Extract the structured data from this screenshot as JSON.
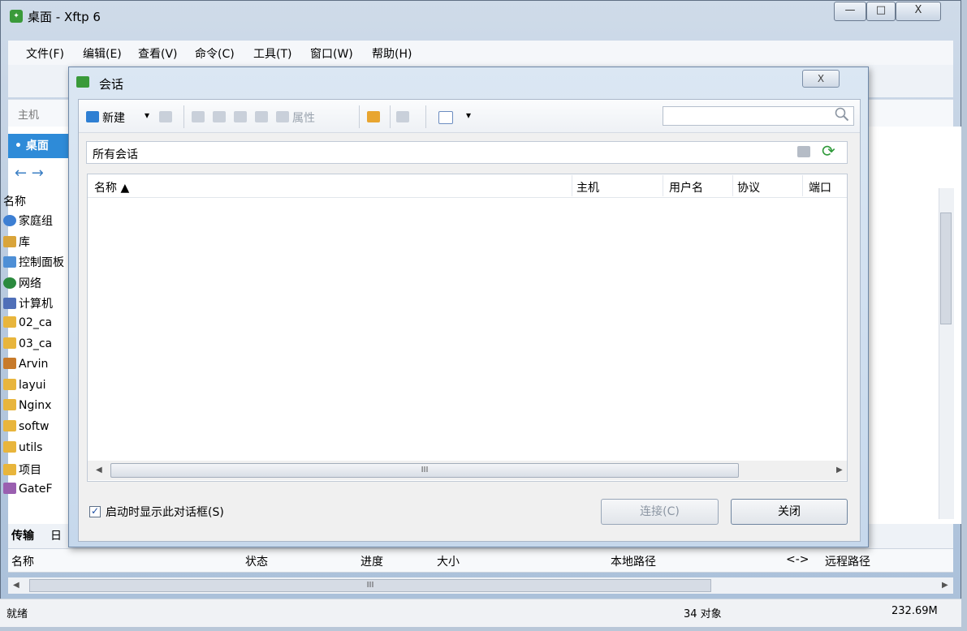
{
  "window": {
    "title": "桌面 - Xftp 6",
    "min_glyph": "—",
    "max_glyph": "□",
    "close_glyph": "X"
  },
  "menu": [
    "文件(F)",
    "编辑(E)",
    "查看(V)",
    "命令(C)",
    "工具(T)",
    "窗口(W)",
    "帮助(H)"
  ],
  "address": {
    "label": "主机"
  },
  "left_pane": {
    "tab": "• 桌面",
    "nav": "← →",
    "header": "名称",
    "items": [
      {
        "label": "家庭组",
        "icon": "homegroup-icon"
      },
      {
        "label": "库",
        "icon": "library-icon"
      },
      {
        "label": "控制面板",
        "icon": "control-panel-icon"
      },
      {
        "label": "网络",
        "icon": "network-icon"
      },
      {
        "label": "计算机",
        "icon": "computer-icon"
      },
      {
        "label": "02_ca",
        "icon": "folder-icon"
      },
      {
        "label": "03_ca",
        "icon": "folder-icon"
      },
      {
        "label": "Arvin",
        "icon": "user-folder-icon"
      },
      {
        "label": "layui",
        "icon": "folder-icon"
      },
      {
        "label": "Nginx",
        "icon": "folder-icon"
      },
      {
        "label": "softw",
        "icon": "folder-icon"
      },
      {
        "label": "utils",
        "icon": "folder-icon"
      },
      {
        "label": "项目",
        "icon": "folder-icon"
      },
      {
        "label": "GateF",
        "icon": "gate-icon"
      }
    ]
  },
  "bottom": {
    "tabs": [
      "传输",
      "日"
    ],
    "columns": [
      "名称",
      "状态",
      "进度",
      "大小",
      "本地路径",
      "<->",
      "远程路径"
    ],
    "scroll_thumb": "III"
  },
  "status": {
    "left": "就绪",
    "count": "34 对象",
    "size": "232.69M"
  },
  "dialog": {
    "title": "会话",
    "close_glyph": "X",
    "toolbar": {
      "new": "新建",
      "properties": "属性",
      "dropdown": "▾"
    },
    "search": {
      "value": ""
    },
    "path": "所有会话",
    "columns": [
      "名称 ▲",
      "主机",
      "用户名",
      "协议",
      "端口"
    ],
    "scroll_thumb": "III",
    "checkbox": {
      "label": "启动时显示此对话框(S)",
      "checked": true,
      "mark": "✓"
    },
    "buttons": {
      "connect": "连接(C)",
      "close": "关闭"
    }
  }
}
